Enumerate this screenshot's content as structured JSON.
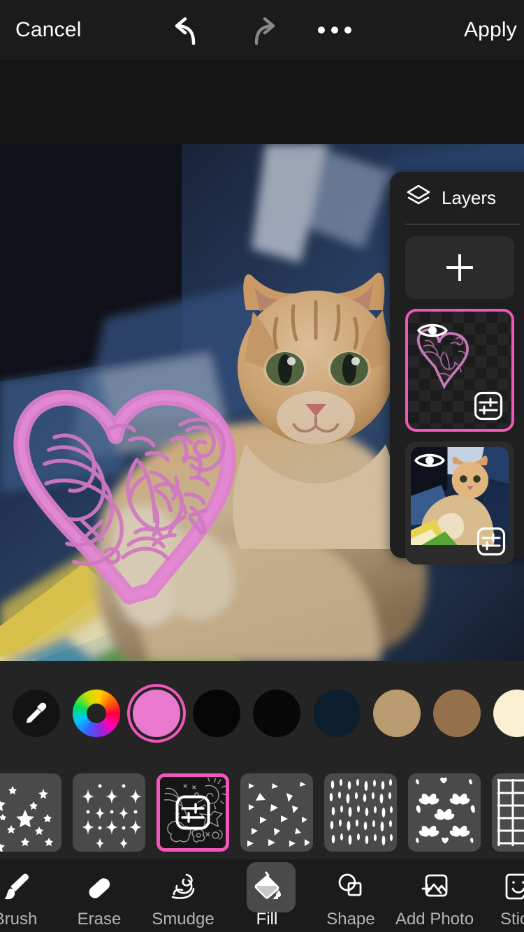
{
  "app": {
    "name": "photo-editor",
    "background": "#161616"
  },
  "topbar": {
    "cancel_label": "Cancel",
    "apply_label": "Apply",
    "undo_icon": "undo-arrow-icon",
    "redo_icon": "redo-arrow-icon",
    "more_icon": "more-options-icon",
    "undo_enabled": "true",
    "redo_enabled": "false"
  },
  "canvas": {
    "name": "image-canvas",
    "photo_description": "orange tabby cat lying on a blue green and yellow blanket",
    "overlay_description": "pink and white doodled heart outline filled with swirls leaves and stars",
    "overlay_color": "#e07fce",
    "overlay_highlight": "#ffffff"
  },
  "layers": {
    "title": "Layers",
    "title_icon": "layers-stack-icon",
    "add_label": "+",
    "add_icon": "plus-icon",
    "items": [
      {
        "name": "doodle-heart-layer",
        "selected": true,
        "visible": true,
        "visibility_icon": "eye-icon",
        "settings_icon": "layer-settings-icon",
        "thumb_type": "transparent-checkerboard"
      },
      {
        "name": "photo-layer",
        "selected": false,
        "visible": true,
        "visibility_icon": "eye-icon",
        "settings_icon": "layer-settings-icon",
        "thumb_type": "photo"
      }
    ]
  },
  "color_palette": {
    "name": "color-swatch-row",
    "swatches": [
      {
        "name": "eyedropper-tool",
        "type": "eyedropper",
        "color": "#131313",
        "selected": false
      },
      {
        "name": "color-wheel",
        "type": "wheel",
        "color": "rainbow",
        "selected": false
      },
      {
        "name": "swatch-pink",
        "type": "solid",
        "color": "#e879cf",
        "selected": true
      },
      {
        "name": "swatch-black-1",
        "type": "solid",
        "color": "#060606",
        "selected": false
      },
      {
        "name": "swatch-black-2",
        "type": "solid",
        "color": "#070707",
        "selected": false
      },
      {
        "name": "swatch-navy",
        "type": "solid",
        "color": "#0c1e2e",
        "selected": false
      },
      {
        "name": "swatch-tan",
        "type": "solid",
        "color": "#b89b6e",
        "selected": false
      },
      {
        "name": "swatch-brown",
        "type": "solid",
        "color": "#94704b",
        "selected": false
      },
      {
        "name": "swatch-cream",
        "type": "solid",
        "color": "#fbefd2",
        "selected": false
      }
    ]
  },
  "pattern_palette": {
    "name": "pattern-swatch-row",
    "patterns": [
      {
        "name": "pattern-stars",
        "label": "stars",
        "selected": false
      },
      {
        "name": "pattern-sparkles",
        "label": "sparkles",
        "selected": false
      },
      {
        "name": "pattern-doodles",
        "label": "doodles",
        "selected": true,
        "settings_icon": "pattern-settings-icon"
      },
      {
        "name": "pattern-triangles",
        "label": "triangles",
        "selected": false
      },
      {
        "name": "pattern-dashes",
        "label": "dashes",
        "selected": false
      },
      {
        "name": "pattern-butterflies",
        "label": "butterflies",
        "selected": false
      },
      {
        "name": "pattern-grid",
        "label": "grid",
        "selected": false
      }
    ]
  },
  "toolbar": {
    "name": "tool-selector",
    "tools": [
      {
        "name": "tool-brush",
        "label": "Brush",
        "icon": "brush-icon",
        "active": false
      },
      {
        "name": "tool-erase",
        "label": "Erase",
        "icon": "eraser-icon",
        "active": false
      },
      {
        "name": "tool-smudge",
        "label": "Smudge",
        "icon": "smudge-icon",
        "active": false
      },
      {
        "name": "tool-fill",
        "label": "Fill",
        "icon": "paint-bucket-icon",
        "active": true
      },
      {
        "name": "tool-shape",
        "label": "Shape",
        "icon": "shapes-icon",
        "active": false
      },
      {
        "name": "tool-add-photo",
        "label": "Add Photo",
        "icon": "add-photo-icon",
        "active": false
      },
      {
        "name": "tool-sticker",
        "label": "Stick",
        "icon": "sticker-icon",
        "active": false
      }
    ]
  },
  "theme": {
    "accent_pink": "#f057b8",
    "bar_bg": "#1b1b1b",
    "panel_bg": "#1f1f1f",
    "palette_bg": "#242424"
  }
}
